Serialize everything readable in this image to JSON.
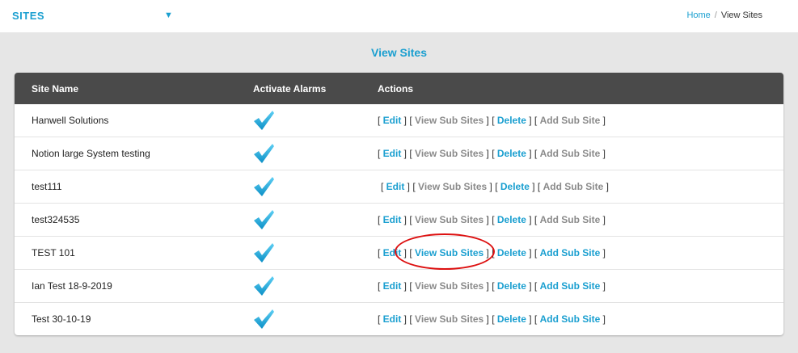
{
  "header": {
    "section_title": "SITES",
    "caret": "▼",
    "breadcrumb": {
      "home": "Home",
      "separator": "/",
      "current": "View Sites"
    }
  },
  "page_heading": "View Sites",
  "table": {
    "columns": [
      "Site Name",
      "Activate Alarms",
      "Actions"
    ],
    "rows": [
      {
        "name": "Hanwell Solutions",
        "actions": [
          "Edit",
          "View Sub Sites",
          "Delete",
          "Add Sub Site"
        ],
        "enabled": [
          true,
          false,
          true,
          false
        ]
      },
      {
        "name": "Notion large System testing",
        "actions": [
          "Edit",
          "View Sub Sites",
          "Delete",
          "Add Sub Site"
        ],
        "enabled": [
          true,
          false,
          true,
          false
        ]
      },
      {
        "name": "test111",
        "actions": [
          "Edit",
          "View Sub Sites",
          "Delete",
          "Add Sub Site"
        ],
        "enabled": [
          true,
          false,
          true,
          false
        ]
      },
      {
        "name": "test324535",
        "actions": [
          "Edit",
          "View Sub Sites",
          "Delete",
          "Add Sub Site"
        ],
        "enabled": [
          true,
          false,
          true,
          false
        ]
      },
      {
        "name": "TEST 101",
        "actions": [
          "Edit",
          "View Sub Sites",
          "Delete",
          "Add Sub Site"
        ],
        "enabled": [
          true,
          true,
          true,
          true
        ]
      },
      {
        "name": "Ian Test 18-9-2019",
        "actions": [
          "Edit",
          "View Sub Sites",
          "Delete",
          "Add Sub Site"
        ],
        "enabled": [
          true,
          false,
          true,
          true
        ]
      },
      {
        "name": "Test 30-10-19",
        "actions": [
          "Edit",
          "View Sub Sites",
          "Delete",
          "Add Sub Site"
        ],
        "enabled": [
          true,
          false,
          true,
          true
        ]
      }
    ],
    "alarm_icon": "checkmark-icon"
  },
  "colors": {
    "accent": "#1a9fd0",
    "disabled": "#8a8a8a",
    "header_bg": "#4a4a4a",
    "highlight": "#dd1111"
  }
}
